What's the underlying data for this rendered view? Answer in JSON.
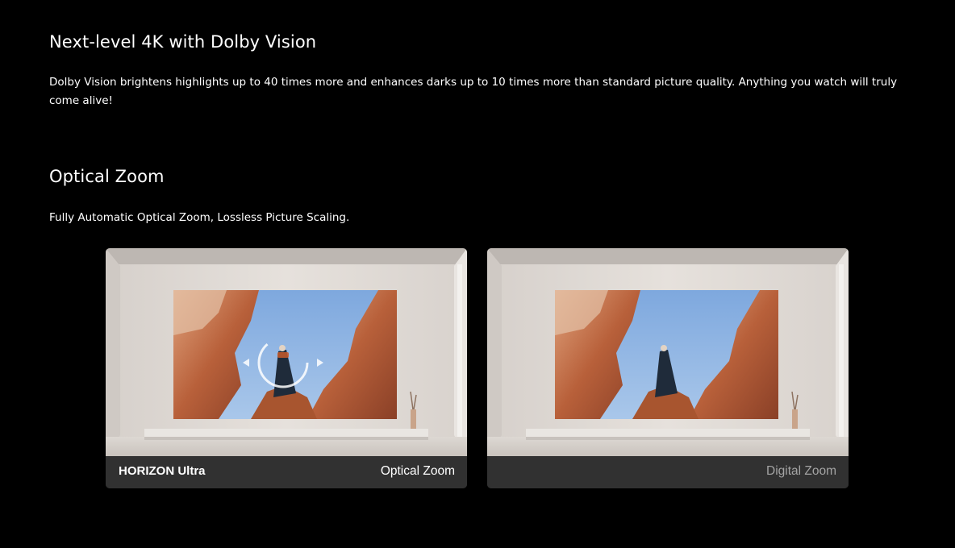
{
  "sections": [
    {
      "title": "Next-level 4K with Dolby Vision",
      "body": "Dolby Vision brightens highlights up to 40 times more and enhances darks up to 10 times more than standard picture quality. Anything you watch will truly come alive!"
    },
    {
      "title": "Optical Zoom",
      "body": "Fully Automatic Optical Zoom, Lossless Picture Scaling."
    }
  ],
  "comparison": {
    "left": {
      "product": "HORIZON Ultra",
      "mode": "Optical Zoom",
      "overlay_icon": "optical-zoom-dial-icon"
    },
    "right": {
      "product": "",
      "mode": "Digital Zoom"
    }
  },
  "colors": {
    "background": "#000000",
    "caption_bar": "#313131",
    "caption_dim": "#a4a4a4",
    "sky": "#8fb6e3",
    "rock": "#c4683a"
  }
}
